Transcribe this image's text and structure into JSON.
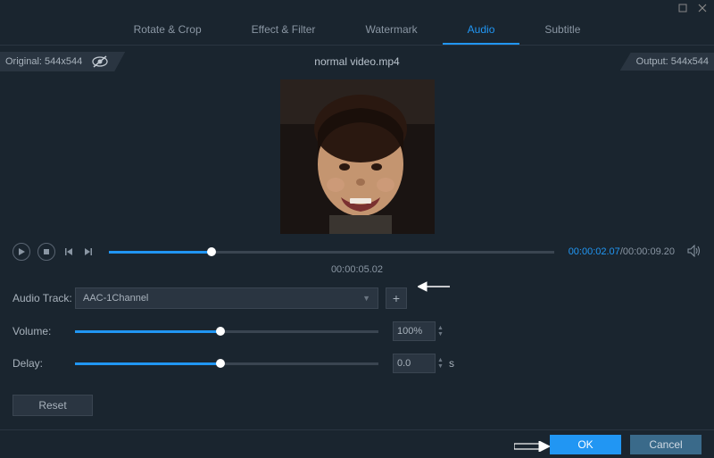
{
  "window": {
    "tabs": [
      {
        "label": "Rotate & Crop",
        "active": false
      },
      {
        "label": "Effect & Filter",
        "active": false
      },
      {
        "label": "Watermark",
        "active": false
      },
      {
        "label": "Audio",
        "active": true
      },
      {
        "label": "Subtitle",
        "active": false
      }
    ]
  },
  "infobar": {
    "original": "Original: 544x544",
    "filename": "normal video.mp4",
    "output": "Output: 544x544"
  },
  "playback": {
    "current": "00:00:02.07",
    "total": "00:00:09.20",
    "marker": "00:00:05.02"
  },
  "audio": {
    "track_label": "Audio Track:",
    "track_value": "AAC-1Channel",
    "volume_label": "Volume:",
    "volume_value": "100%",
    "delay_label": "Delay:",
    "delay_value": "0.0",
    "delay_unit": "s"
  },
  "buttons": {
    "reset": "Reset",
    "ok": "OK",
    "cancel": "Cancel",
    "add": "+"
  }
}
